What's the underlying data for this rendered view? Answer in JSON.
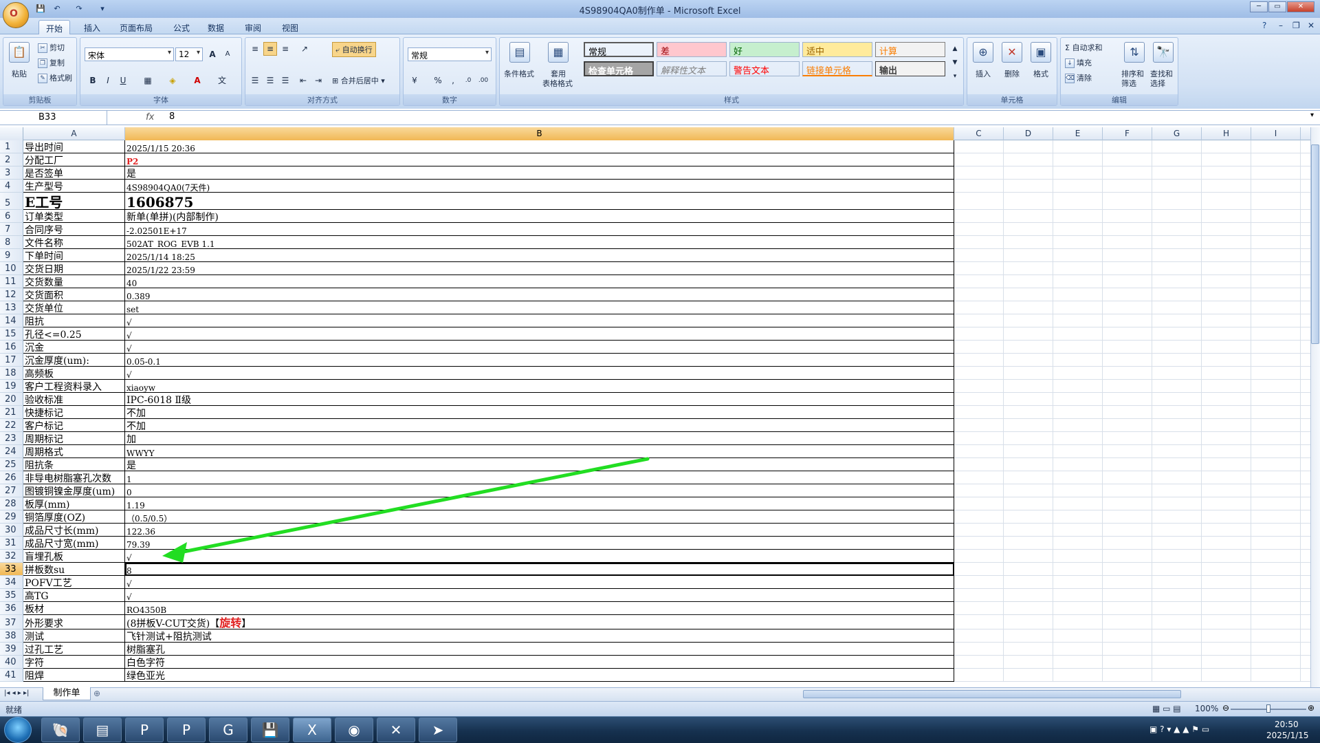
{
  "window": {
    "title": "4S98904QA0制作单 - Microsoft Excel",
    "office_button_label": "O"
  },
  "quick_access": [
    "💾",
    "↶",
    "↷",
    "▾"
  ],
  "tabs": [
    "开始",
    "插入",
    "页面布局",
    "公式",
    "数据",
    "审阅",
    "视图"
  ],
  "ribbon": {
    "clipboard": {
      "name": "剪贴板",
      "paste": "粘贴",
      "cut": "剪切",
      "copy": "复制",
      "format_painter": "格式刷"
    },
    "font": {
      "name": "字体",
      "font_name": "宋体",
      "font_size": "12",
      "bold": "B",
      "italic": "I",
      "underline": "U",
      "grow": "A",
      "shrink": "A"
    },
    "alignment": {
      "name": "对齐方式",
      "wrap": "自动换行",
      "merge": "合并后居中"
    },
    "number": {
      "name": "数字",
      "format": "常规",
      "percent": "%",
      "comma": ",",
      "inc": ".0",
      "dec": ".00"
    },
    "styles": {
      "name": "样式",
      "conditional": "条件格式",
      "table_format": "套用",
      "table_format2": "表格格式",
      "cells": [
        {
          "label": "常规",
          "bg": "#ffffff",
          "color": "#000000"
        },
        {
          "label": "差",
          "bg": "#ffc7ce",
          "color": "#9c0006"
        },
        {
          "label": "好",
          "bg": "#c6efce",
          "color": "#006100"
        },
        {
          "label": "适中",
          "bg": "#ffeb9c",
          "color": "#9c6500"
        },
        {
          "label": "计算",
          "bg": "#f2f2f2",
          "color": "#fa7d00"
        },
        {
          "label": "检查单元格",
          "bg": "#a5a5a5",
          "color": "#ffffff"
        },
        {
          "label": "解释性文本",
          "bg": "#ffffff",
          "color": "#7f7f7f"
        },
        {
          "label": "警告文本",
          "bg": "#ffffff",
          "color": "#ff0000"
        },
        {
          "label": "链接单元格",
          "bg": "#ffffff",
          "color": "#fa7d00"
        },
        {
          "label": "输出",
          "bg": "#f2f2f2",
          "color": "#3f3f3f"
        }
      ]
    },
    "cells_group": {
      "name": "单元格",
      "insert": "插入",
      "delete": "删除",
      "format": "格式"
    },
    "editing": {
      "name": "编辑",
      "autosum": "Σ 自动求和",
      "fill": "填充",
      "clear": "清除",
      "sort": "排序和",
      "sort2": "筛选",
      "find": "查找和",
      "find2": "选择"
    }
  },
  "formula_bar": {
    "name_box": "B33",
    "fx": "fx",
    "value": "8"
  },
  "columns": [
    "A",
    "B",
    "C",
    "D",
    "E",
    "F",
    "G",
    "H",
    "I"
  ],
  "rows": [
    {
      "n": "1",
      "a": "导出时间",
      "b": "2025/1/15 20:36"
    },
    {
      "n": "2",
      "a": "分配工厂",
      "b": "P2"
    },
    {
      "n": "3",
      "a": "是否签单",
      "b": "是"
    },
    {
      "n": "4",
      "a": "生产型号",
      "b": "4S98904QA0(7天件)"
    },
    {
      "n": "5",
      "a": "E工号",
      "b": "1606875"
    },
    {
      "n": "6",
      "a": "订单类型",
      "b": "新单(单拼)(内部制作)"
    },
    {
      "n": "7",
      "a": "合同序号",
      "b": "-2.02501E+17"
    },
    {
      "n": "8",
      "a": "文件名称",
      "b": "502AT_ROG_EVB 1.1"
    },
    {
      "n": "9",
      "a": "下单时间",
      "b": "2025/1/14 18:25"
    },
    {
      "n": "10",
      "a": "交货日期",
      "b": "2025/1/22 23:59"
    },
    {
      "n": "11",
      "a": "交货数量",
      "b": "40"
    },
    {
      "n": "12",
      "a": "交货面积",
      "b": "0.389"
    },
    {
      "n": "13",
      "a": "交货单位",
      "b": "set"
    },
    {
      "n": "14",
      "a": "阻抗",
      "b": "√"
    },
    {
      "n": "15",
      "a": "孔径<=0.25",
      "b": "√"
    },
    {
      "n": "16",
      "a": "沉金",
      "b": "√"
    },
    {
      "n": "17",
      "a": "沉金厚度(um):",
      "b": "0.05-0.1"
    },
    {
      "n": "18",
      "a": "高频板",
      "b": "√"
    },
    {
      "n": "19",
      "a": "客户工程资料录入",
      "b": "xiaoyw"
    },
    {
      "n": "20",
      "a": "验收标准",
      "b": "IPC-6018 Ⅱ级"
    },
    {
      "n": "21",
      "a": "快捷标记",
      "b": "不加"
    },
    {
      "n": "22",
      "a": "客户标记",
      "b": "不加"
    },
    {
      "n": "23",
      "a": "周期标记",
      "b": "加"
    },
    {
      "n": "24",
      "a": "周期格式",
      "b": "WWYY"
    },
    {
      "n": "25",
      "a": "阻抗条",
      "b": "是"
    },
    {
      "n": "26",
      "a": "非导电树脂塞孔次数",
      "b": "1"
    },
    {
      "n": "27",
      "a": "图镀铜镍金厚度(um)",
      "b": "0"
    },
    {
      "n": "28",
      "a": "板厚(mm)",
      "b": "1.19"
    },
    {
      "n": "29",
      "a": "铜箔厚度(OZ)",
      "b": "（0.5/0.5）"
    },
    {
      "n": "30",
      "a": "成品尺寸长(mm)",
      "b": "122.36"
    },
    {
      "n": "31",
      "a": "成品尺寸宽(mm)",
      "b": "79.39"
    },
    {
      "n": "32",
      "a": "盲埋孔板",
      "b": "√"
    },
    {
      "n": "33",
      "a": "拼板数su",
      "b": "8"
    },
    {
      "n": "34",
      "a": "POFV工艺",
      "b": "√"
    },
    {
      "n": "35",
      "a": "高TG",
      "b": "√"
    },
    {
      "n": "36",
      "a": "板材",
      "b": "RO4350B"
    },
    {
      "n": "37",
      "a": "外形要求",
      "b": "(8拼板V-CUT交货)【",
      "b_red": "旋转",
      "b_tail": "】"
    },
    {
      "n": "38",
      "a": "测试",
      "b": "飞针测试+阻抗测试"
    },
    {
      "n": "39",
      "a": "过孔工艺",
      "b": "树脂塞孔"
    },
    {
      "n": "40",
      "a": "字符",
      "b": "白色字符"
    },
    {
      "n": "41",
      "a": "阻焊",
      "b": "绿色亚光"
    }
  ],
  "sheet_tab": "制作单",
  "status": {
    "ready": "就绪",
    "zoom": "100%"
  },
  "taskbar": {
    "apps": [
      "🐚",
      "▤",
      "P",
      "P",
      "G",
      "💾",
      "X",
      "◉",
      "✕",
      "➤"
    ],
    "time": "20:50",
    "date": "2025/1/15"
  },
  "colors": {
    "accent_arrow": "#22dd22",
    "selected_header": "#f1b855",
    "red_text": "#e02020"
  }
}
